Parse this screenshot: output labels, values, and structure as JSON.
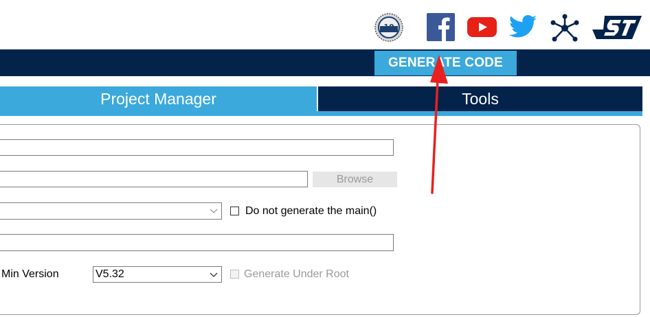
{
  "header": {
    "badge_number": "10",
    "social_icons": [
      "anniversary-badge-icon",
      "facebook-icon",
      "youtube-icon",
      "twitter-icon",
      "network-icon",
      "st-logo-icon"
    ],
    "colors": {
      "facebook": "#3b5998",
      "youtube": "#e62117",
      "twitter": "#1da1f2",
      "st_logo": "#03234b"
    }
  },
  "toolbar": {
    "generate_code_label": "GENERATE CODE"
  },
  "tabs": [
    {
      "label": "Project Manager",
      "active": true
    },
    {
      "label": "Tools",
      "active": false
    }
  ],
  "form": {
    "browse_label": "Browse",
    "do_not_generate_main_label": "Do not generate the main()",
    "min_version_label": "Min Version",
    "min_version_value": "V5.32",
    "generate_under_root_label": "Generate Under Root"
  },
  "colors": {
    "accent": "#3ba9dc",
    "navy": "#03234b",
    "annotation_arrow": "#e8201f"
  }
}
